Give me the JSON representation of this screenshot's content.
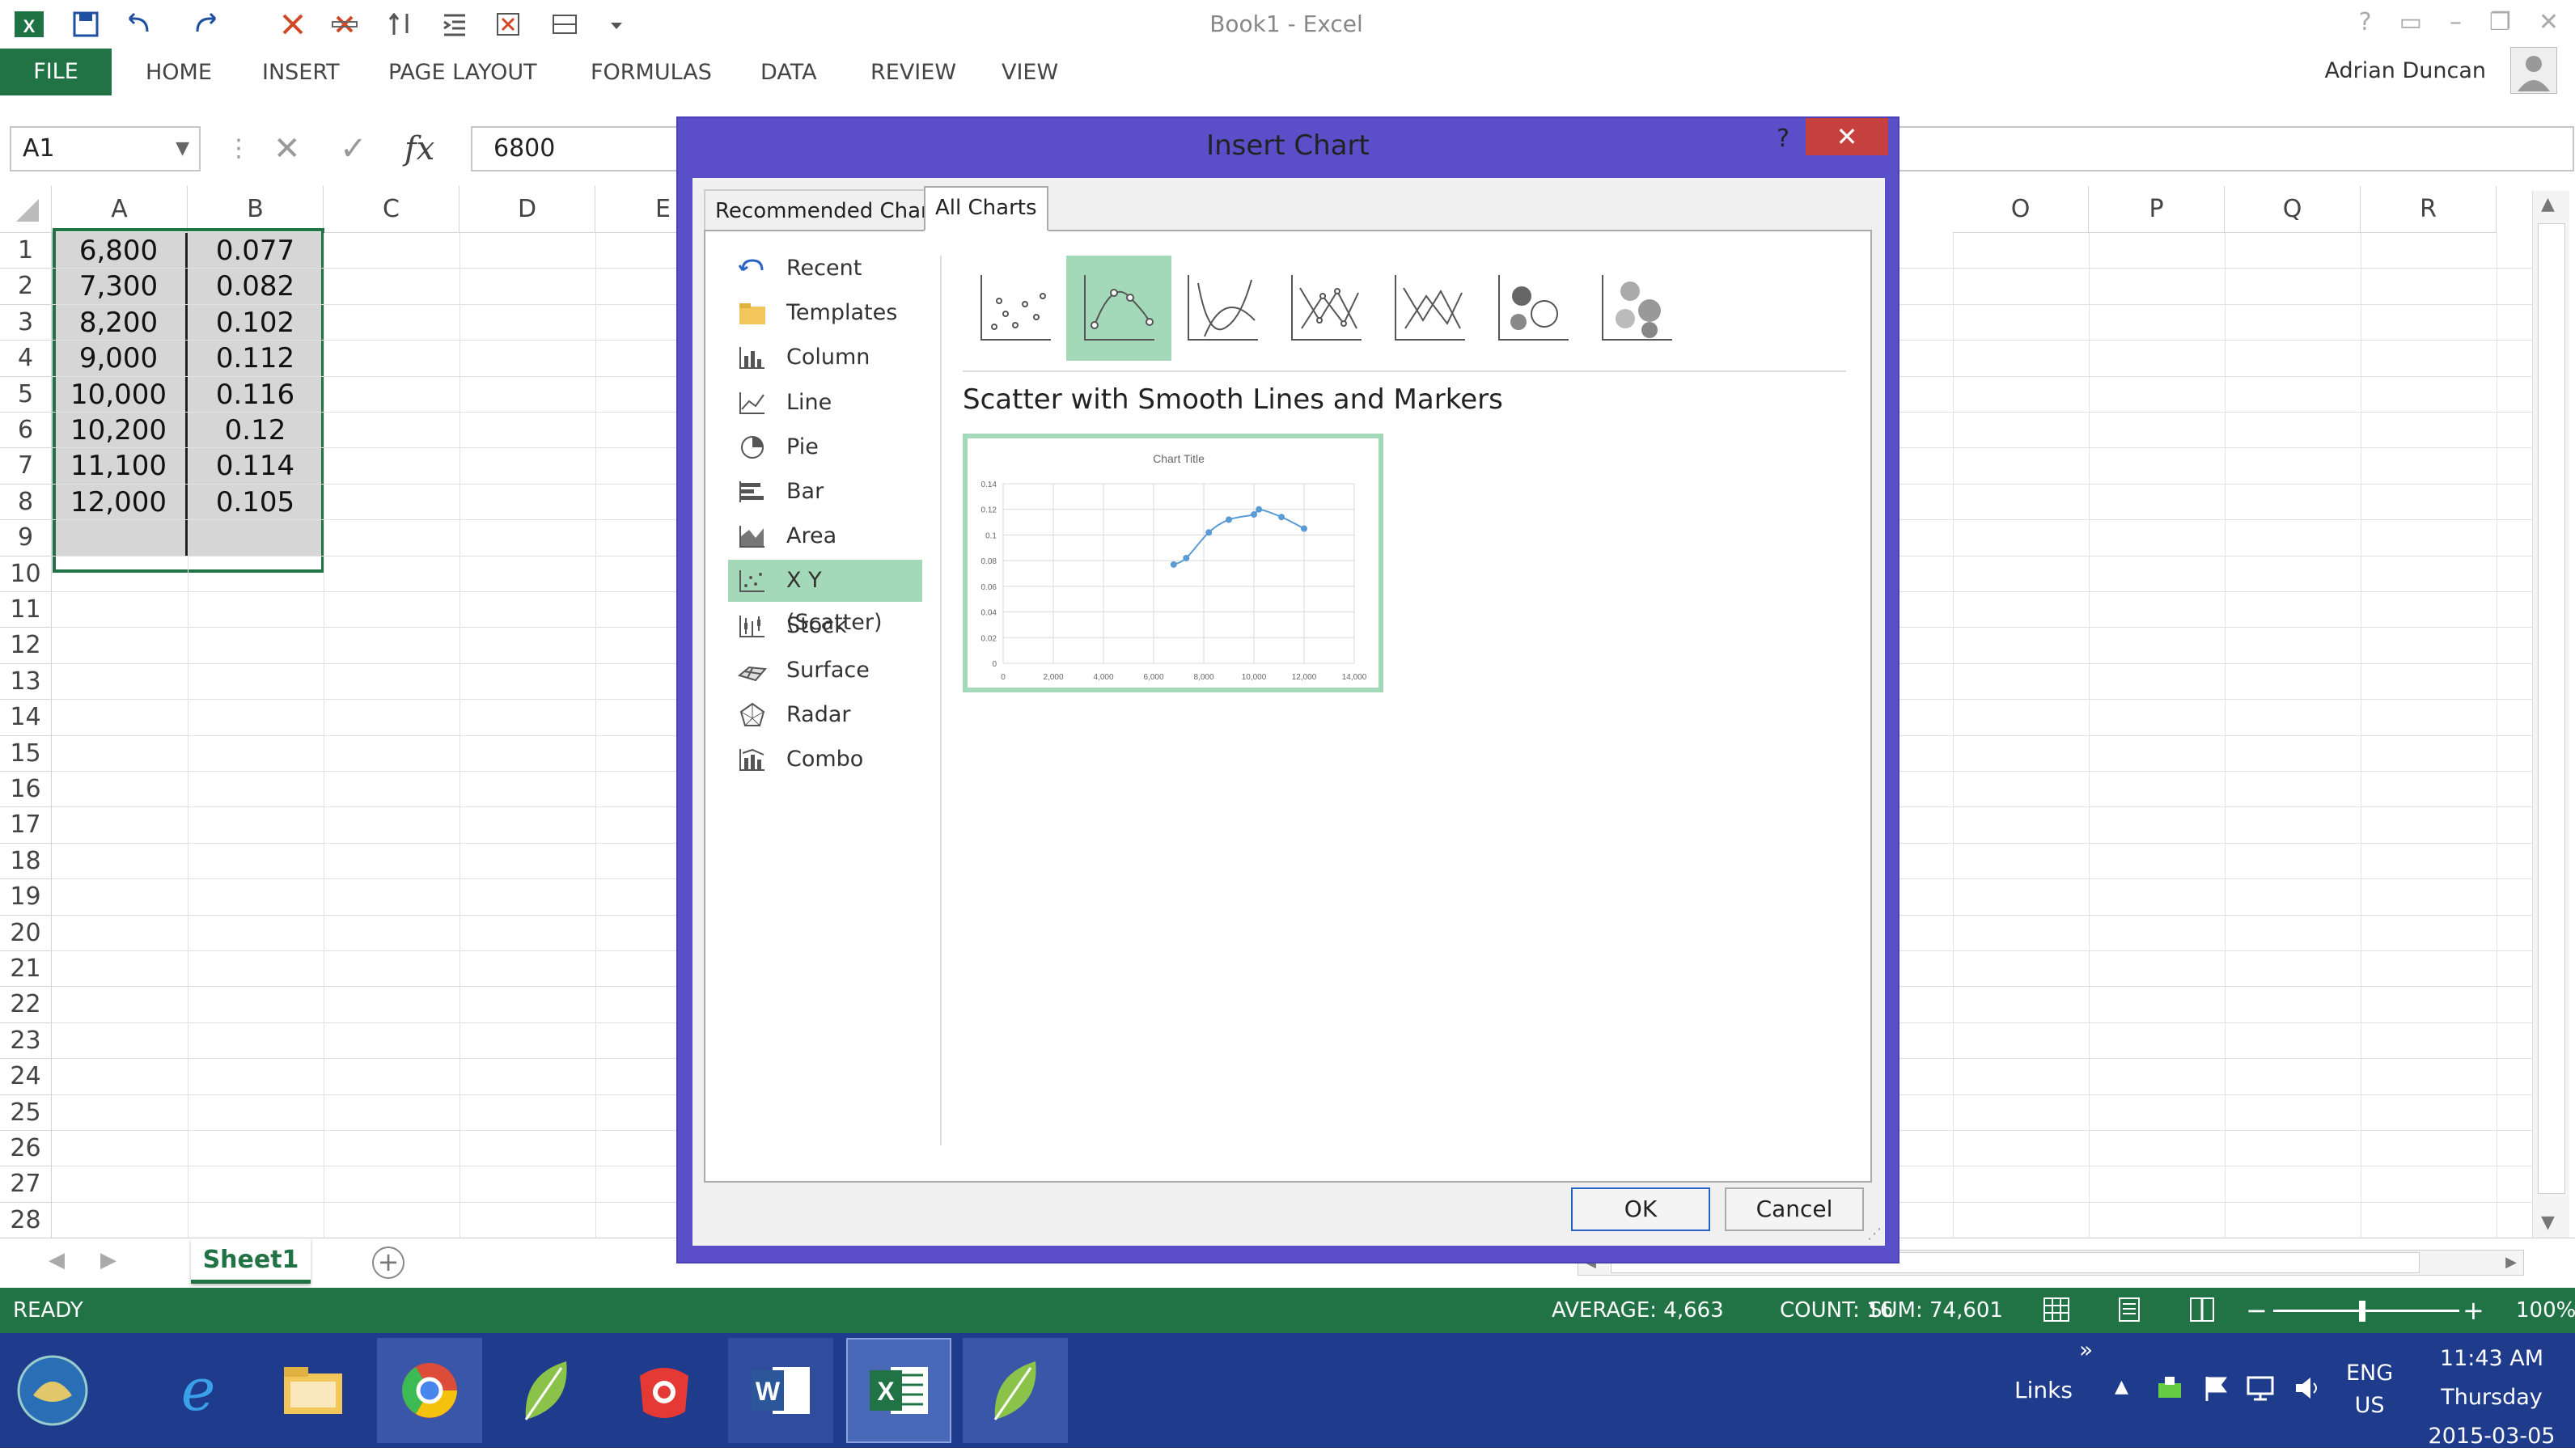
{
  "window": {
    "title": "Book1 - Excel",
    "user": "Adrian Duncan"
  },
  "ribbon": {
    "file": "FILE",
    "tabs": [
      "HOME",
      "INSERT",
      "PAGE LAYOUT",
      "FORMULAS",
      "DATA",
      "REVIEW",
      "VIEW"
    ]
  },
  "formula_bar": {
    "name_box": "A1",
    "value": "6800",
    "fx": "fx"
  },
  "grid": {
    "columns": [
      "A",
      "B",
      "C",
      "D",
      "E",
      "O",
      "P",
      "Q",
      "R"
    ],
    "rows": [
      "1",
      "2",
      "3",
      "4",
      "5",
      "6",
      "7",
      "8",
      "9",
      "10",
      "11",
      "12",
      "13",
      "14",
      "15",
      "16",
      "17",
      "18",
      "19",
      "20",
      "21",
      "22",
      "23",
      "24",
      "25",
      "26",
      "27",
      "28"
    ],
    "col_a": [
      "6,800",
      "7,300",
      "8,200",
      "9,000",
      "10,000",
      "10,200",
      "11,100",
      "12,000"
    ],
    "col_b": [
      "0.077",
      "0.082",
      "0.102",
      "0.112",
      "0.116",
      "0.12",
      "0.114",
      "0.105"
    ]
  },
  "sheet_tab": "Sheet1",
  "status": {
    "ready": "READY",
    "average": "AVERAGE: 4,663",
    "count": "COUNT: 16",
    "sum": "SUM: 74,601",
    "zoom": "100%"
  },
  "dialog": {
    "title": "Insert Chart",
    "help": "?",
    "tabs": [
      "Recommended Charts",
      "All Charts"
    ],
    "categories": [
      "Recent",
      "Templates",
      "Column",
      "Line",
      "Pie",
      "Bar",
      "Area",
      "X Y (Scatter)",
      "Stock",
      "Surface",
      "Radar",
      "Combo"
    ],
    "selected_type_name": "Scatter with Smooth Lines and Markers",
    "ok": "OK",
    "cancel": "Cancel",
    "accent": "#a3d9b8"
  },
  "preview_chart": {
    "title": "Chart Title",
    "y_ticks": [
      "0.14",
      "0.12",
      "0.1",
      "0.08",
      "0.06",
      "0.04",
      "0.02",
      "0"
    ],
    "x_ticks": [
      "0",
      "2,000",
      "4,000",
      "6,000",
      "8,000",
      "10,000",
      "12,000",
      "14,000"
    ]
  },
  "chart_data": {
    "type": "scatter",
    "title": "Chart Title",
    "x": [
      6800,
      7300,
      8200,
      9000,
      10000,
      10200,
      11100,
      12000
    ],
    "y": [
      0.077,
      0.082,
      0.102,
      0.112,
      0.116,
      0.12,
      0.114,
      0.105
    ],
    "xlim": [
      0,
      14000
    ],
    "ylim": [
      0,
      0.14
    ],
    "grid": true
  },
  "taskbar": {
    "links": "Links",
    "lang1": "ENG",
    "lang2": "US",
    "time": "11:43 AM",
    "day": "Thursday",
    "date": "2015-03-05",
    "more": "»"
  }
}
